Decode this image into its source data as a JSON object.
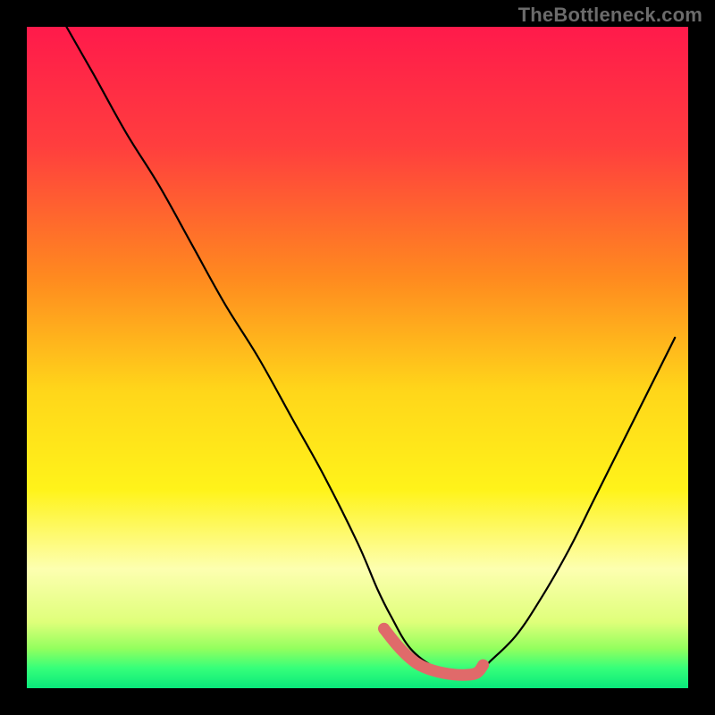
{
  "attribution": "TheBottleneck.com",
  "chart_data": {
    "type": "line",
    "title": "",
    "xlabel": "",
    "ylabel": "",
    "xlim": [
      0,
      100
    ],
    "ylim": [
      0,
      100
    ],
    "annotations": [
      "V-shaped bottleneck curve with minimum plateau highlighted"
    ],
    "series": [
      {
        "name": "curve",
        "x": [
          6,
          10,
          15,
          20,
          25,
          30,
          35,
          40,
          45,
          50,
          53,
          55,
          58,
          62,
          66,
          68,
          70,
          74,
          78,
          82,
          86,
          90,
          94,
          98
        ],
        "y": [
          100,
          93,
          84,
          76,
          67,
          58,
          50,
          41,
          32,
          22,
          15,
          11,
          6,
          3,
          2,
          2,
          4,
          8,
          14,
          21,
          29,
          37,
          45,
          53
        ]
      },
      {
        "name": "plateau-highlight",
        "x": [
          54,
          56,
          58,
          60,
          63,
          66,
          68,
          69
        ],
        "y": [
          9,
          6.5,
          4.5,
          3.2,
          2.3,
          2.0,
          2.3,
          3.5
        ]
      }
    ],
    "background_gradient": {
      "stops": [
        {
          "offset": 0.0,
          "color": "#ff1a4b"
        },
        {
          "offset": 0.18,
          "color": "#ff3e3e"
        },
        {
          "offset": 0.38,
          "color": "#ff8a1f"
        },
        {
          "offset": 0.55,
          "color": "#ffd61a"
        },
        {
          "offset": 0.7,
          "color": "#fff31a"
        },
        {
          "offset": 0.82,
          "color": "#fdffb0"
        },
        {
          "offset": 0.9,
          "color": "#dfff7a"
        },
        {
          "offset": 0.94,
          "color": "#93ff5e"
        },
        {
          "offset": 0.97,
          "color": "#35ff7a"
        },
        {
          "offset": 1.0,
          "color": "#09e87b"
        }
      ]
    },
    "colors": {
      "curve": "#000000",
      "highlight": "#e06a6a"
    }
  }
}
